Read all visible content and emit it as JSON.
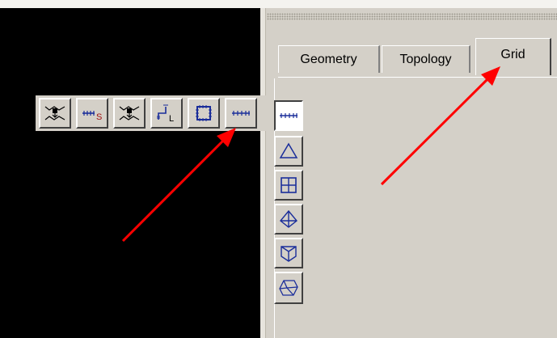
{
  "tabs": [
    {
      "label": "Geometry",
      "active": false
    },
    {
      "label": "Topology",
      "active": false
    },
    {
      "label": "Grid",
      "active": true
    }
  ],
  "horizontal_toolbar": {
    "buttons": [
      {
        "icon": "mesh-edge-hedge-icon"
      },
      {
        "icon": "edge-spacing-s-icon"
      },
      {
        "icon": "mesh-edge-hedge-2-icon"
      },
      {
        "icon": "edge-link-l-icon"
      },
      {
        "icon": "face-square-dots-icon"
      },
      {
        "icon": "edge-mesh-icon",
        "selected": true
      }
    ]
  },
  "vertical_toolbar": {
    "buttons": [
      {
        "icon": "edge-mesh-icon",
        "selected": true
      },
      {
        "icon": "triangle-icon"
      },
      {
        "icon": "quad-grid-icon"
      },
      {
        "icon": "tetrahedron-icon"
      },
      {
        "icon": "hex-volume-icon"
      },
      {
        "icon": "polyhedron-icon"
      }
    ]
  },
  "colors": {
    "annotation_arrow": "#ff0000",
    "viewport_bg": "#000000",
    "panel_bg": "#d4d0c8"
  }
}
